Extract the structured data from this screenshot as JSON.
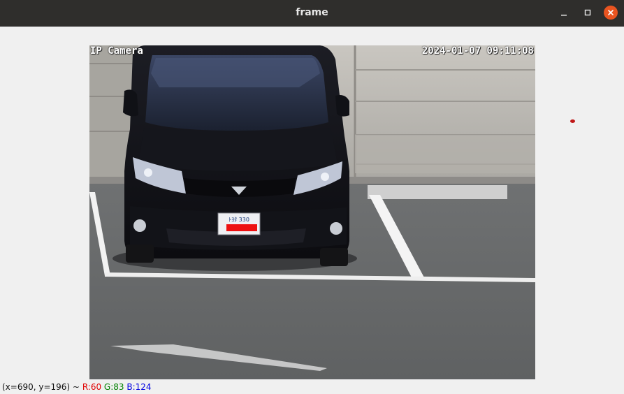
{
  "window": {
    "title": "frame"
  },
  "video": {
    "camera_label": "IP Camera",
    "timestamp": "2024-01-07 09:11:08",
    "plate_text": "ﾄﾖﾀ 330"
  },
  "status": {
    "position": "(x=690, y=196) ~",
    "r": "R:60",
    "g": "G:83",
    "b": "B:124",
    "colors": {
      "r": "#e00000",
      "g": "#008000",
      "b": "#0000e0"
    }
  },
  "icons": {
    "minimize": "minimize-icon",
    "maximize": "maximize-icon",
    "close": "close-icon"
  }
}
